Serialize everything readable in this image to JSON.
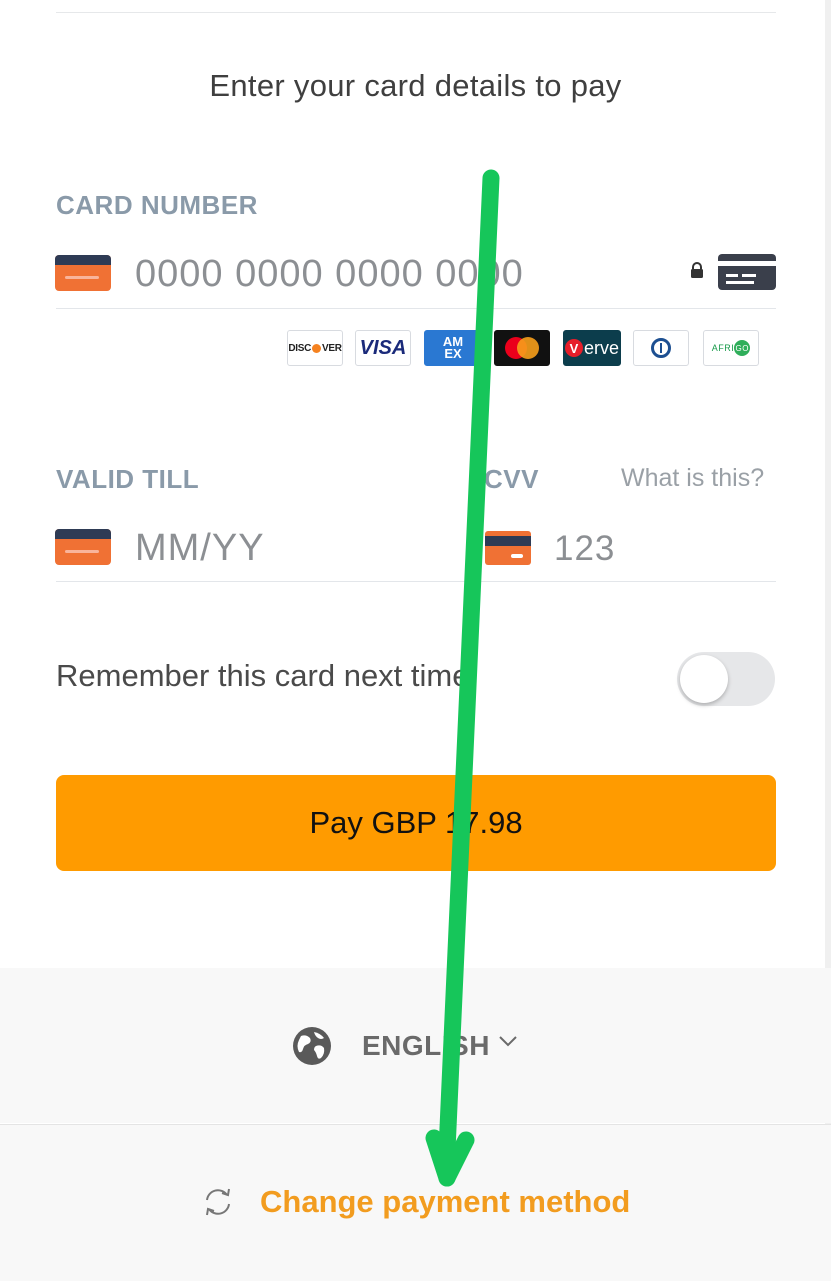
{
  "header": {
    "title": "Enter your card details to pay"
  },
  "card_number": {
    "label": "CARD NUMBER",
    "placeholder": "0000 0000 0000 0000",
    "icons": [
      "card-icon",
      "lock-icon",
      "generic-card-icon"
    ]
  },
  "brands": [
    {
      "name": "DISCOVER"
    },
    {
      "name": "VISA"
    },
    {
      "name": "AMEX"
    },
    {
      "name": "mastercard"
    },
    {
      "name": "Verve"
    },
    {
      "name": "Diners Club"
    },
    {
      "name": "AFRIGO"
    }
  ],
  "expiry": {
    "label": "VALID TILL",
    "placeholder": "MM/YY"
  },
  "cvv": {
    "label": "CVV",
    "help": "What is this?",
    "placeholder": "123"
  },
  "remember": {
    "label": "Remember this card next time",
    "enabled": false
  },
  "pay_button": {
    "label": "Pay GBP 17.98"
  },
  "language": {
    "label": "ENGLISH",
    "icon": "globe-icon"
  },
  "change_method": {
    "label": "Change payment method",
    "icon": "refresh-icon"
  },
  "colors": {
    "accent": "#ff9b00",
    "link": "#f29c1f",
    "label": "#8a9aa9",
    "annotation_arrow": "#16c65a"
  }
}
